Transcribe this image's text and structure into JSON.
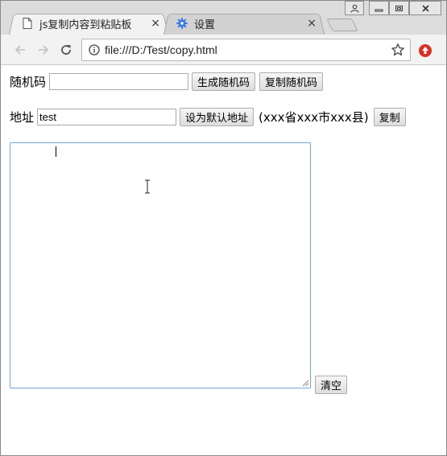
{
  "browser": {
    "tabs": [
      {
        "label": "js复制内容到粘贴板",
        "icon": "document-icon",
        "active": true
      },
      {
        "label": "设置",
        "icon": "settings-gear-icon",
        "active": false
      }
    ],
    "tab_close_glyph": "×",
    "address_bar": {
      "url": "file:///D:/Test/copy.html"
    }
  },
  "form": {
    "random_code": {
      "label": "随机码",
      "value": "",
      "generate_button": "生成随机码",
      "copy_button": "复制随机码"
    },
    "address": {
      "label": "地址",
      "value": "test",
      "set_default_button": "设为默认地址",
      "format_hint": "(xxx省xxx市xxx县)",
      "copy_button": "复制"
    },
    "paste_area": {
      "value": ""
    },
    "clear_button": "清空"
  },
  "colors": {
    "accent_focus": "#7aa1d6",
    "tab_strip": "#dcdcdc",
    "toolbar": "#f2f2f2",
    "extension_red": "#d93025"
  }
}
